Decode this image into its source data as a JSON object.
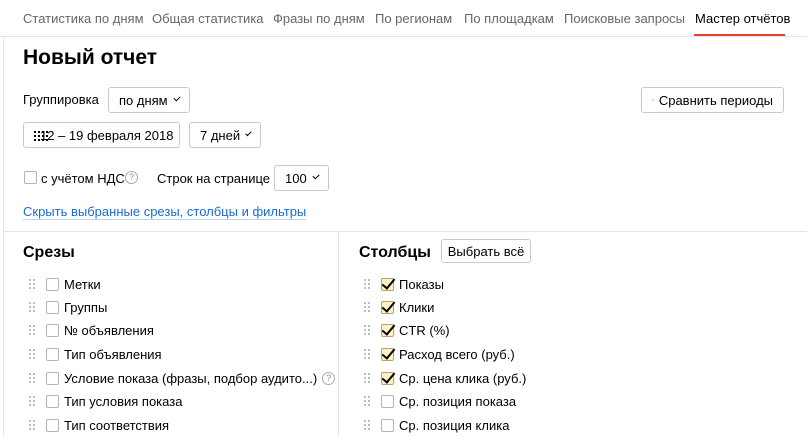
{
  "tabs": [
    {
      "label": "Статистика по дням"
    },
    {
      "label": "Общая статистика"
    },
    {
      "label": "Фразы по дням"
    },
    {
      "label": "По регионам"
    },
    {
      "label": "По площадкам"
    },
    {
      "label": "Поисковые запросы"
    },
    {
      "label": "Мастер отчётов",
      "active": true
    }
  ],
  "title": "Новый отчет",
  "grouping": {
    "label": "Группировка",
    "value": "по дням"
  },
  "compare_button": {
    "label": "Сравнить периоды",
    "icon": "compare-icon"
  },
  "date_range": {
    "value": "12 – 19 февраля 2018",
    "icon": "calendar-icon"
  },
  "period": {
    "value": "7 дней"
  },
  "vat": {
    "label": "с учётом НДС",
    "checked": false
  },
  "rows_per_page": {
    "label": "Строк на странице",
    "value": "100"
  },
  "toggle_link": "Скрыть выбранные срезы, столбцы и фильтры",
  "slices": {
    "title": "Срезы",
    "items": [
      {
        "label": "Метки",
        "checked": false
      },
      {
        "label": "Группы",
        "checked": false
      },
      {
        "label": "№ объявления",
        "checked": false
      },
      {
        "label": "Тип объявления",
        "checked": false
      },
      {
        "label": "Условие показа (фразы, подбор аудито...)",
        "checked": false,
        "help": true
      },
      {
        "label": "Тип условия показа",
        "checked": false
      },
      {
        "label": "Тип соответствия",
        "checked": false
      }
    ]
  },
  "columns": {
    "title": "Столбцы",
    "select_all_label": "Выбрать всё",
    "items": [
      {
        "label": "Показы",
        "checked": true
      },
      {
        "label": "Клики",
        "checked": true
      },
      {
        "label": "CTR (%)",
        "checked": true
      },
      {
        "label": "Расход всего (руб.)",
        "checked": true
      },
      {
        "label": "Ср. цена клика (руб.)",
        "checked": true
      },
      {
        "label": "Ср. позиция показа",
        "checked": false
      },
      {
        "label": "Ср. позиция клика",
        "checked": false
      }
    ]
  },
  "colors": {
    "accent_underline": "#e8402f",
    "link": "#1b6ad7",
    "checked_bg": "#fff1c2"
  }
}
